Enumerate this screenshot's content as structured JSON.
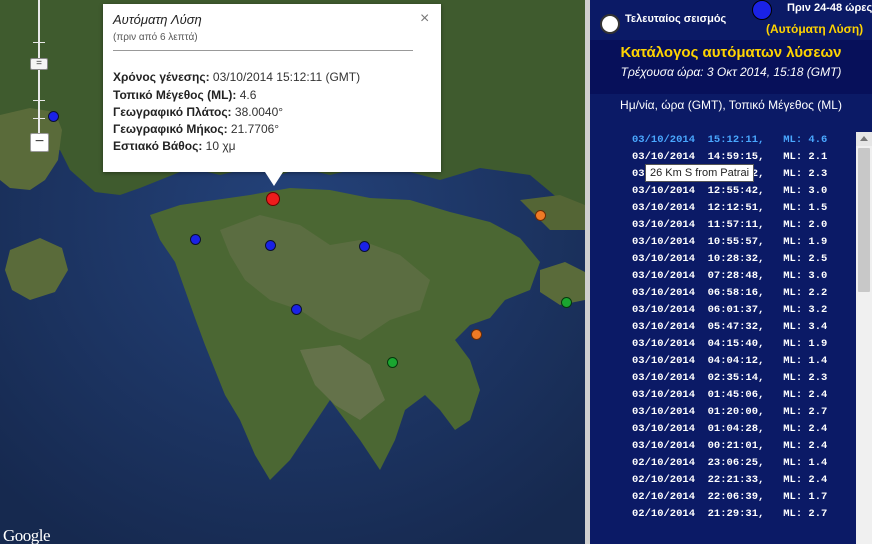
{
  "map": {
    "attribution": "Google",
    "zoom": {
      "minus_label": "−",
      "handle_label": "="
    },
    "pins": [
      {
        "color": "red",
        "label": "latest"
      },
      {
        "color": "blue"
      },
      {
        "color": "blue"
      },
      {
        "color": "blue"
      },
      {
        "color": "blue"
      },
      {
        "color": "blue"
      },
      {
        "color": "orange"
      },
      {
        "color": "orange"
      },
      {
        "color": "green"
      },
      {
        "color": "green"
      }
    ],
    "colors": {
      "sea": "#1c3566",
      "land": "#3e5a2c",
      "red_pin": "#ee1c1c",
      "blue_pin": "#1a22e6",
      "orange_pin": "#f07a25",
      "green_pin": "#1aa630"
    }
  },
  "popup": {
    "title": "Αυτόματη Λύση",
    "subtitle": "(πριν από 6 λεπτά)",
    "close_icon": "close-icon",
    "rows": [
      {
        "label": "Χρόνος γένεσης:",
        "value": " 03/10/2014  15:12:11 (GMT)"
      },
      {
        "label": "Τοπικό Μέγεθος (ML):",
        "value": " 4.6"
      },
      {
        "label": "Γεωγραφικό Πλάτος:",
        "value": " 38.0040°"
      },
      {
        "label": "Γεωγραφικό Μήκος:",
        "value": " 21.7706°"
      },
      {
        "label": "Εστιακό Βάθος:",
        "value": " 10 χμ"
      }
    ]
  },
  "tooltip": {
    "text": "26 Km S from Patrai"
  },
  "legend": {
    "latest_label": "Τελευταίος σεισμός",
    "older_label": "Πριν 24-48 ώρες",
    "auto_label": "(Αυτόματη Λύση)",
    "colors": {
      "accent": "#ffd400",
      "panel_bg": "#0b1a66"
    }
  },
  "panel": {
    "title": "Κατάλογος αυτόματων λύσεων",
    "current_time": "Τρέχουσα ώρα: 3 Οκτ 2014, 15:18 (GMT)",
    "column_header": "Ημ/νία, ώρα (GMT), Τοπικό Μέγεθος (ML)",
    "list": [
      "03/10/2014  15:12:11,   ML: 4.6",
      "03/10/2014  14:59:15,   ML: 2.1",
      "03/10/2014  13:04:42,   ML: 2.3",
      "03/10/2014  12:55:42,   ML: 3.0",
      "03/10/2014  12:12:51,   ML: 1.5",
      "03/10/2014  11:57:11,   ML: 2.0",
      "03/10/2014  10:55:57,   ML: 1.9",
      "03/10/2014  10:28:32,   ML: 2.5",
      "03/10/2014  07:28:48,   ML: 3.0",
      "03/10/2014  06:58:16,   ML: 2.2",
      "03/10/2014  06:01:37,   ML: 3.2",
      "03/10/2014  05:47:32,   ML: 3.4",
      "03/10/2014  04:15:40,   ML: 1.9",
      "03/10/2014  04:04:12,   ML: 1.4",
      "03/10/2014  02:35:14,   ML: 2.3",
      "03/10/2014  01:45:06,   ML: 2.4",
      "03/10/2014  01:20:00,   ML: 2.7",
      "03/10/2014  01:04:28,   ML: 2.4",
      "03/10/2014  00:21:01,   ML: 2.4",
      "02/10/2014  23:06:25,   ML: 1.4",
      "02/10/2014  22:21:33,   ML: 2.4",
      "02/10/2014  22:06:39,   ML: 1.7",
      "02/10/2014  21:29:31,   ML: 2.7"
    ]
  }
}
